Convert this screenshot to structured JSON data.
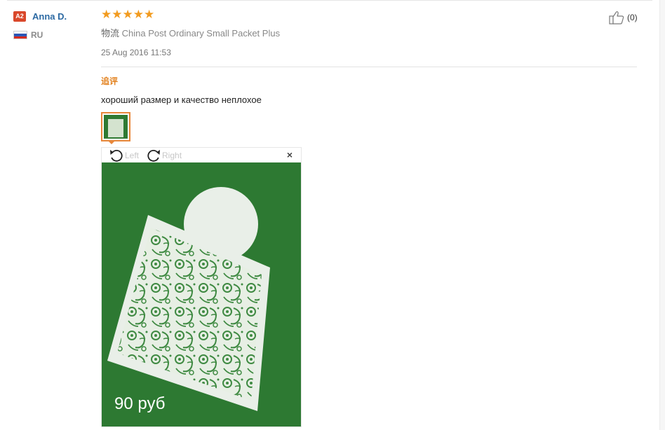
{
  "buyer": {
    "level_badge": "A2",
    "name": "Anna D.",
    "country": "RU"
  },
  "review": {
    "rating": 5,
    "stars": [
      "★",
      "★",
      "★",
      "★",
      "★"
    ],
    "shipping_label": "物流",
    "shipping_method": "China Post Ordinary Small Packet Plus",
    "date": "25 Aug 2016 11:53",
    "feedback_tag": "追评",
    "feedback_text": "хороший размер и качество неплохое",
    "helpful_count": "(0)"
  },
  "viewer": {
    "rotate_left_label": "Left",
    "rotate_right_label": "Right",
    "close_glyph": "×",
    "photo_caption": "90 руб"
  },
  "icons": {
    "thumb_up": "thumbs-up-icon",
    "rotate_left": "rotate-left-icon",
    "rotate_right": "rotate-right-icon",
    "close": "close-icon",
    "flag": "russia-flag-icon"
  },
  "colors": {
    "star": "#f29b1f",
    "name": "#2d6aa3",
    "badge": "#d9482b",
    "tag": "#e2811e",
    "photo_background": "#2f7a33"
  }
}
